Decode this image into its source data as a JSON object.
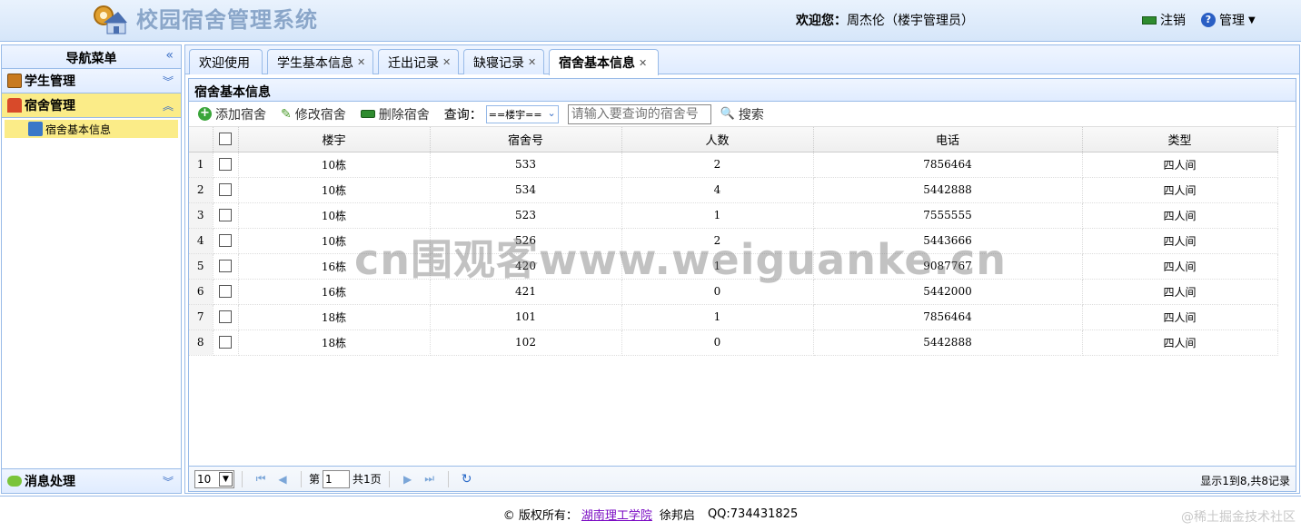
{
  "header": {
    "title": "校园宿舍管理系统",
    "welcome_label": "欢迎您：",
    "user": "周杰伦（楼宇管理员）",
    "logout": "注销",
    "manage": "管理"
  },
  "nav": {
    "title": "导航菜单",
    "collapse_icon": "«",
    "sections": [
      {
        "label": "学生管理",
        "chevron": "︾"
      },
      {
        "label": "宿舍管理",
        "chevron": "︽",
        "items": [
          {
            "label": "宿舍基本信息"
          }
        ]
      },
      {
        "label": "消息处理",
        "chevron": "︾"
      }
    ]
  },
  "tabs": [
    {
      "label": "欢迎使用"
    },
    {
      "label": "学生基本信息"
    },
    {
      "label": "迁出记录"
    },
    {
      "label": "缺寝记录"
    },
    {
      "label": "宿舍基本信息"
    }
  ],
  "panel": {
    "title": "宿舍基本信息",
    "toolbar": {
      "add": "添加宿舍",
      "edit": "修改宿舍",
      "delete": "删除宿舍",
      "query_label": "查询：",
      "building_select": "==楼宇==",
      "search_placeholder": "请输入要查询的宿舍号",
      "search": "搜索"
    },
    "columns": [
      "楼宇",
      "宿舍号",
      "人数",
      "电话",
      "类型"
    ],
    "rows": [
      {
        "n": "1",
        "building": "10栋",
        "room": "533",
        "count": "2",
        "phone": "7856464",
        "type": "四人间"
      },
      {
        "n": "2",
        "building": "10栋",
        "room": "534",
        "count": "4",
        "phone": "5442888",
        "type": "四人间"
      },
      {
        "n": "3",
        "building": "10栋",
        "room": "523",
        "count": "1",
        "phone": "7555555",
        "type": "四人间"
      },
      {
        "n": "4",
        "building": "10栋",
        "room": "526",
        "count": "2",
        "phone": "5443666",
        "type": "四人间"
      },
      {
        "n": "5",
        "building": "16栋",
        "room": "420",
        "count": "1",
        "phone": "9087767",
        "type": "四人间"
      },
      {
        "n": "6",
        "building": "16栋",
        "room": "421",
        "count": "0",
        "phone": "5442000",
        "type": "四人间"
      },
      {
        "n": "7",
        "building": "18栋",
        "room": "101",
        "count": "1",
        "phone": "7856464",
        "type": "四人间"
      },
      {
        "n": "8",
        "building": "18栋",
        "room": "102",
        "count": "0",
        "phone": "5442888",
        "type": "四人间"
      }
    ],
    "pager": {
      "page_size": "10",
      "page_label": "第",
      "page": "1",
      "total_pages": "共1页",
      "info": "显示1到8,共8记录"
    }
  },
  "footer": {
    "copyright": "© 版权所有：",
    "school": "湖南理工学院",
    "author": "徐邦启",
    "qq": "QQ:734431825"
  },
  "watermark": "cn围观客www.weiguanke.cn",
  "corner_mark": "@稀土掘金技术社区"
}
